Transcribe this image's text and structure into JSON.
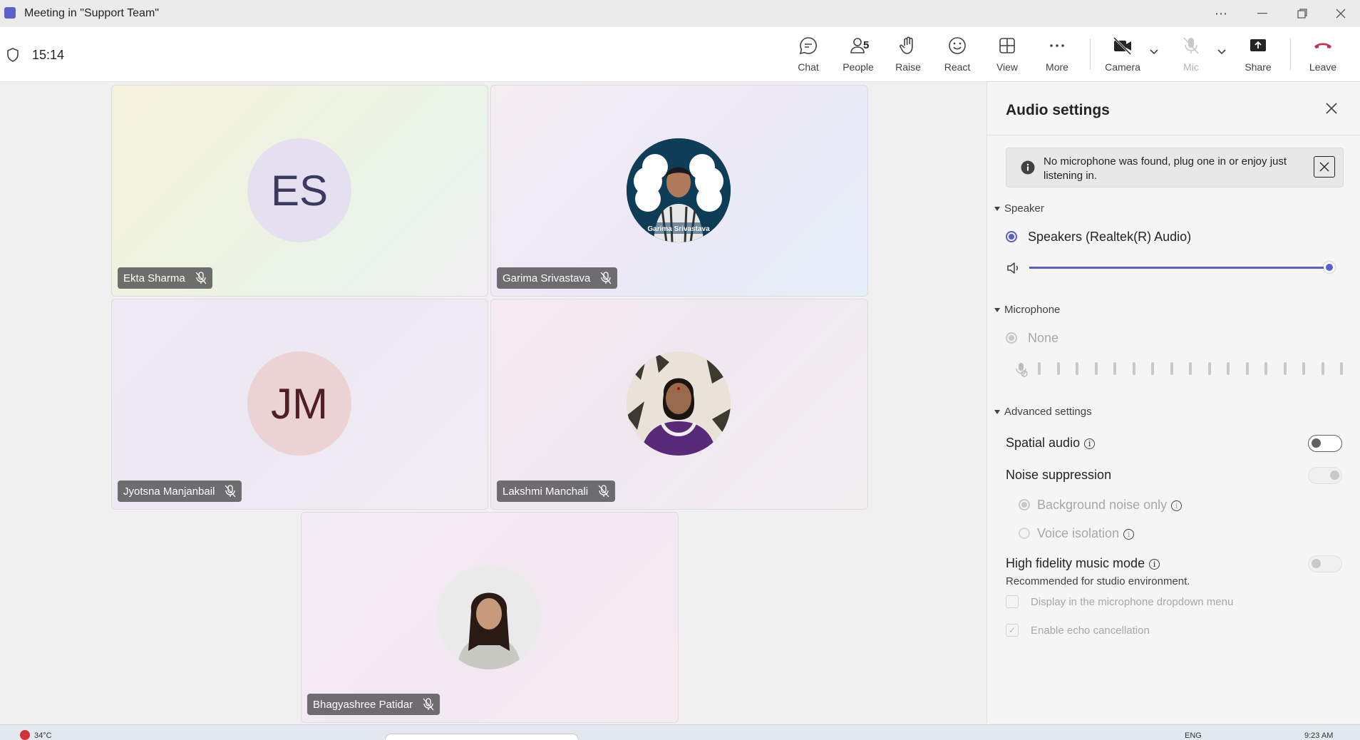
{
  "window": {
    "title": "Meeting in \"Support Team\""
  },
  "meeting": {
    "time": "15:14"
  },
  "toolbar": {
    "chat": "Chat",
    "people": "People",
    "people_count": "5",
    "raise": "Raise",
    "react": "React",
    "view": "View",
    "more": "More",
    "camera": "Camera",
    "mic": "Mic",
    "share": "Share",
    "leave": "Leave"
  },
  "participants": [
    {
      "name": "Ekta Sharma",
      "initials": "ES",
      "bg": "#e4e0f0",
      "fg": "#3b3a5c"
    },
    {
      "name": "Garima Srivastava",
      "photo_caption": "Garima Srivastava"
    },
    {
      "name": "Jyotsna Manjanbail",
      "initials": "JM",
      "bg": "#ecd3d3",
      "fg": "#4f1f24"
    },
    {
      "name": "Lakshmi Manchali"
    },
    {
      "name": "Bhagyashree Patidar"
    }
  ],
  "audio_settings": {
    "title": "Audio settings",
    "banner": "No microphone was found, plug one in or enjoy just listening in.",
    "speaker_section": "Speaker",
    "speaker_device": "Speakers (Realtek(R) Audio)",
    "speaker_volume_pct": 100,
    "microphone_section": "Microphone",
    "microphone_device": "None",
    "advanced_section": "Advanced settings",
    "spatial_audio": "Spatial audio",
    "noise_suppression": "Noise suppression",
    "noise_option_1": "Background noise only",
    "noise_option_2": "Voice isolation",
    "hifi_mode": "High fidelity music mode",
    "hifi_desc": "Recommended for studio environment.",
    "display_dropdown": "Display in the microphone dropdown menu",
    "echo_cancellation": "Enable echo cancellation"
  },
  "taskbar": {
    "temp": "34°C",
    "lang": "ENG",
    "clock": "9:23 AM"
  },
  "colors": {
    "accent": "#5b5fc7",
    "leave": "#c4314b"
  }
}
